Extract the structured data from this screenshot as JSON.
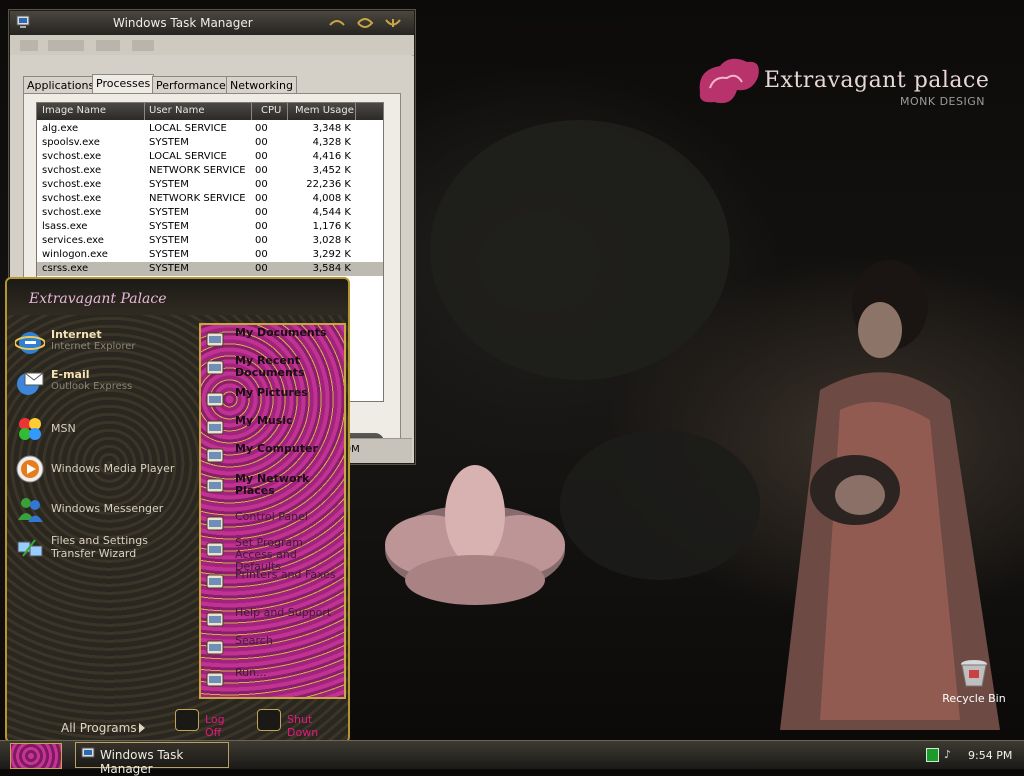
{
  "brand": {
    "title": "Extravagant palace",
    "subtitle": "MONK DESIGN"
  },
  "desktop": {
    "recycle_bin_label": "Recycle Bin"
  },
  "task_manager": {
    "title": "Windows Task Manager",
    "tabs": [
      {
        "label": "Applications",
        "active": false
      },
      {
        "label": "Processes",
        "active": true
      },
      {
        "label": "Performance",
        "active": false
      },
      {
        "label": "Networking",
        "active": false
      }
    ],
    "columns": [
      "Image Name",
      "User Name",
      "CPU",
      "Mem Usage"
    ],
    "rows": [
      [
        "alg.exe",
        "LOCAL SERVICE",
        "00",
        "3,348 K"
      ],
      [
        "spoolsv.exe",
        "SYSTEM",
        "00",
        "4,328 K"
      ],
      [
        "svchost.exe",
        "LOCAL SERVICE",
        "00",
        "4,416 K"
      ],
      [
        "svchost.exe",
        "NETWORK SERVICE",
        "00",
        "3,452 K"
      ],
      [
        "svchost.exe",
        "SYSTEM",
        "00",
        "22,236 K"
      ],
      [
        "svchost.exe",
        "NETWORK SERVICE",
        "00",
        "4,008 K"
      ],
      [
        "svchost.exe",
        "SYSTEM",
        "00",
        "4,544 K"
      ],
      [
        "lsass.exe",
        "SYSTEM",
        "00",
        "1,176 K"
      ],
      [
        "services.exe",
        "SYSTEM",
        "00",
        "3,028 K"
      ],
      [
        "winlogon.exe",
        "SYSTEM",
        "00",
        "3,292 K"
      ],
      [
        "csrss.exe",
        "SYSTEM",
        "00",
        "3,584 K"
      ]
    ],
    "selected_row": 10,
    "end_process_partial": "cess",
    "status_partial": "249M"
  },
  "start_menu": {
    "header_logo": "Extravagant Palace",
    "pinned": [
      {
        "title": "Internet",
        "subtitle": "Internet Explorer",
        "icon": "internet-explorer-icon"
      },
      {
        "title": "E-mail",
        "subtitle": "Outlook Express",
        "icon": "outlook-express-icon"
      }
    ],
    "recent": [
      {
        "label": "MSN",
        "icon": "msn-icon"
      },
      {
        "label": "Windows Media Player",
        "icon": "media-player-icon"
      },
      {
        "label": "Windows Messenger",
        "icon": "messenger-icon"
      },
      {
        "label": "Files and Settings Transfer Wizard",
        "icon": "transfer-wizard-icon"
      }
    ],
    "all_programs": "All Programs",
    "right": [
      {
        "label": "My Documents",
        "icon": "my-documents-icon"
      },
      {
        "label": "My Recent Documents",
        "icon": "recent-documents-icon"
      },
      {
        "label": "My Pictures",
        "icon": "my-pictures-icon"
      },
      {
        "label": "My Music",
        "icon": "my-music-icon"
      },
      {
        "label": "My Computer",
        "icon": "my-computer-icon"
      },
      {
        "label": "My Network Places",
        "icon": "network-places-icon"
      },
      {
        "label": "Control Panel",
        "icon": "control-panel-icon"
      },
      {
        "label": "Set Program Access and Defaults",
        "icon": "program-access-icon"
      },
      {
        "label": "Printers and Faxes",
        "icon": "printers-icon"
      },
      {
        "label": "Help and Support",
        "icon": "help-icon"
      },
      {
        "label": "Search",
        "icon": "search-icon"
      },
      {
        "label": "Run...",
        "icon": "run-icon"
      }
    ],
    "log_off": "Log Off",
    "shut_down": "Shut Down"
  },
  "taskbar": {
    "task_label": "Windows Task Manager",
    "clock": "9:54 PM"
  },
  "colors": {
    "accent_gold": "#c9a544",
    "accent_pink": "#c03392",
    "shutdown_text": "#e41a7c"
  }
}
